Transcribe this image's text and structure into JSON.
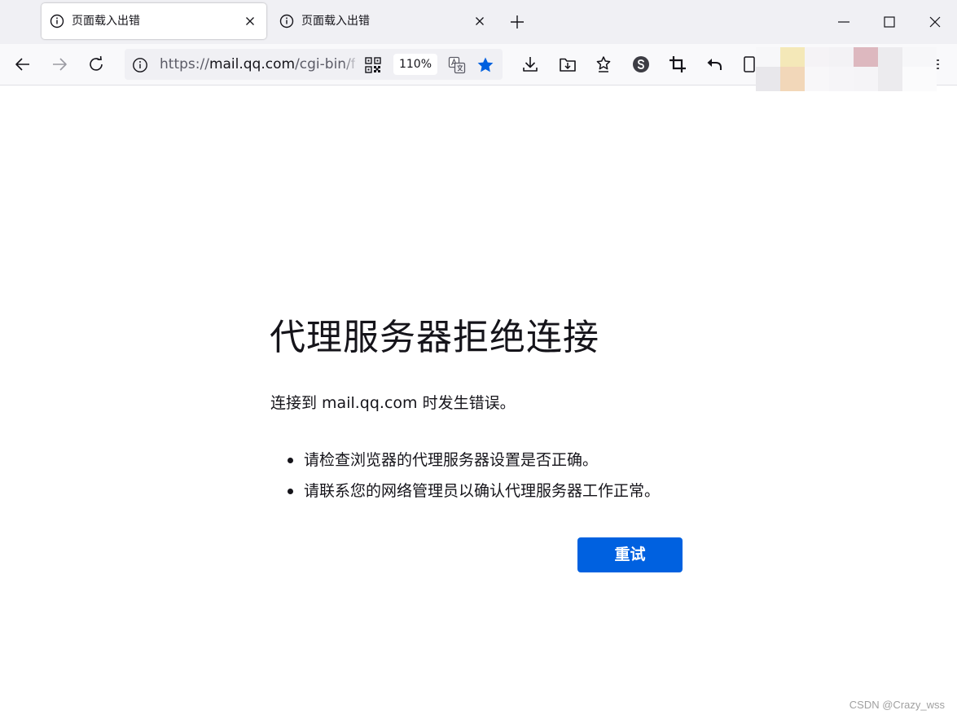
{
  "tabs": [
    {
      "title": "页面载入出错",
      "active": true
    },
    {
      "title": "页面载入出错",
      "active": false
    }
  ],
  "toolbar": {
    "url_prefix": "https://",
    "url_host": "mail.qq.com",
    "url_path": "/cgi-bin/frame_html",
    "zoom": "110%"
  },
  "error": {
    "title": "代理服务器拒绝连接",
    "description": "连接到 mail.qq.com 时发生错误。",
    "suggestions": [
      "请检查浏览器的代理服务器设置是否正确。",
      "请联系您的网络管理员以确认代理服务器工作正常。"
    ],
    "retry_label": "重试"
  },
  "watermark": "CSDN @Crazy_wss",
  "colors": {
    "accent": "#0061e0",
    "star": "#0060df"
  }
}
